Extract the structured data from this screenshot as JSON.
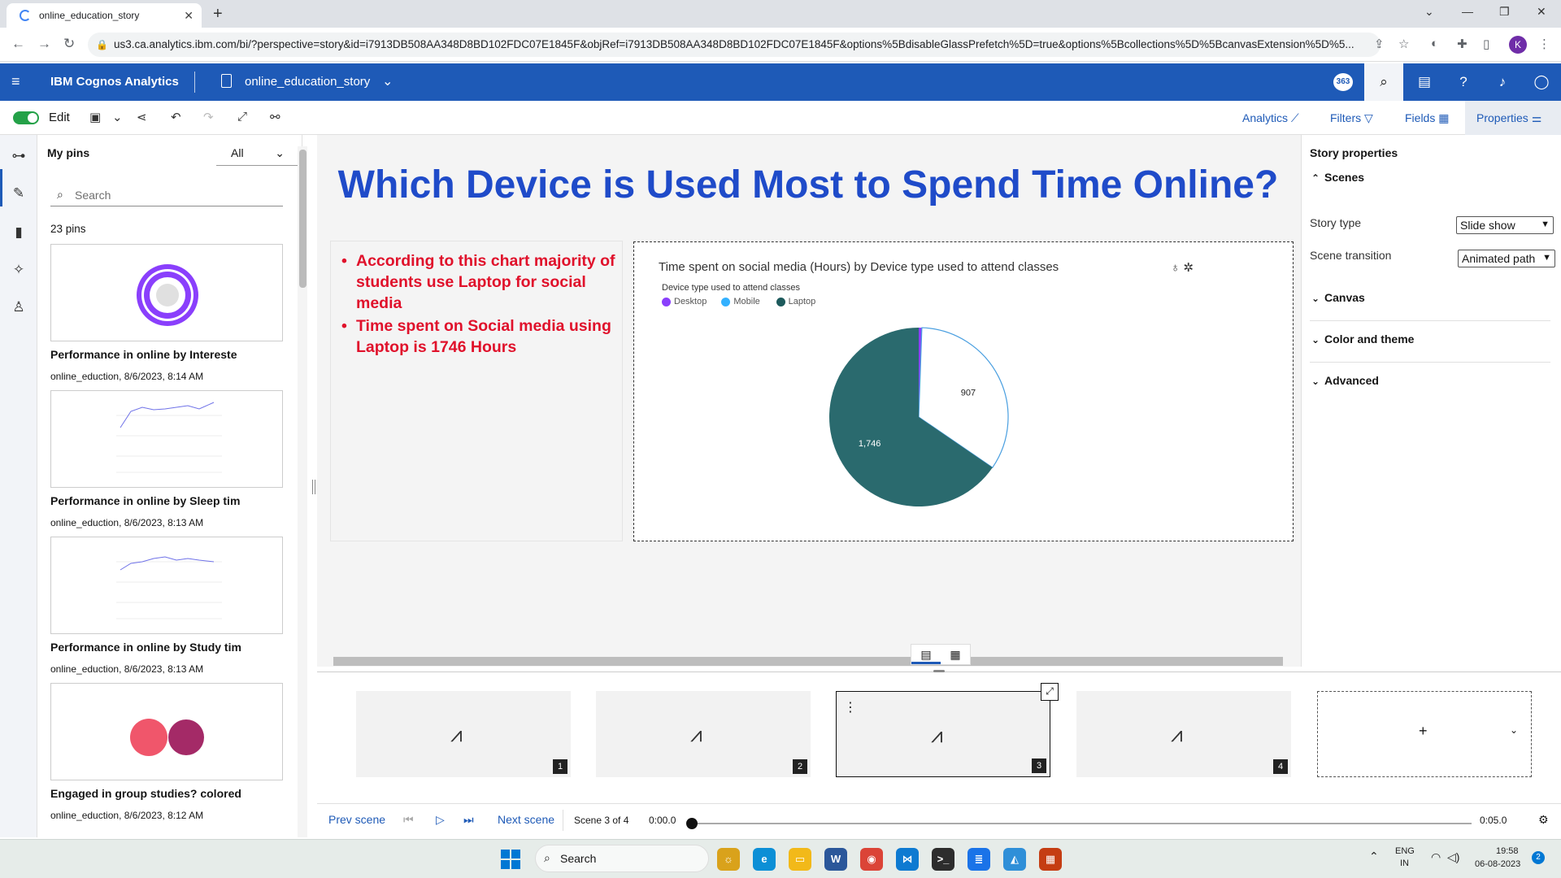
{
  "browser": {
    "tab_title": "online_education_story",
    "url": "us3.ca.analytics.ibm.com/bi/?perspective=story&id=i7913DB508AA348D8BD102FDC07E1845F&objRef=i7913DB508AA348D8BD102FDC07E1845F&options%5BdisableGlassPrefetch%5D=true&options%5Bcollections%5D%5BcanvasExtension%5D%5...",
    "profile_initial": "K"
  },
  "header": {
    "brand": "IBM Cognos Analytics",
    "story_name": "online_education_story",
    "badge": "363"
  },
  "toolbar": {
    "edit_label": "Edit",
    "analytics_label": "Analytics",
    "filters_label": "Filters",
    "fields_label": "Fields",
    "properties_label": "Properties"
  },
  "pins": {
    "title": "My pins",
    "filter_value": "All",
    "search_placeholder": "Search",
    "count": "23 pins",
    "items": [
      {
        "title": "Performance in online by Intereste",
        "meta": "online_eduction, 8/6/2023, 8:14 AM"
      },
      {
        "title": "Performance in online by Sleep tim",
        "meta": "online_eduction, 8/6/2023, 8:13 AM"
      },
      {
        "title": "Performance in online by Study tim",
        "meta": "online_eduction, 8/6/2023, 8:13 AM"
      },
      {
        "title": "Engaged in group studies? colored",
        "meta": "online_eduction, 8/6/2023, 8:12 AM"
      }
    ]
  },
  "slide": {
    "title": "Which Device is Used Most to Spend Time Online?",
    "bullets": [
      "According to this chart majority of students use Laptop for social media",
      "Time spent on Social media using Laptop is 1746 Hours"
    ]
  },
  "chart_data": {
    "type": "pie",
    "title": "Time spent on social media (Hours) by Device type used to attend classes",
    "legend_title": "Device type used to attend classes",
    "legend_position": "top-left",
    "categories": [
      "Desktop",
      "Mobile",
      "Laptop"
    ],
    "values": [
      15,
      907,
      1746
    ],
    "data_labels": [
      "",
      "907",
      "1,746"
    ],
    "colors": [
      "#8a3ffc",
      "#ffffff",
      "#2a6a6e"
    ],
    "legend_colors": [
      "#8a3ffc",
      "#33b1ff",
      "#1d5a5c"
    ]
  },
  "properties": {
    "title": "Story properties",
    "scenes_label": "Scenes",
    "story_type_label": "Story type",
    "story_type_value": "Slide show",
    "scene_transition_label": "Scene transition",
    "scene_transition_value": "Animated path",
    "canvas_label": "Canvas",
    "color_theme_label": "Color and theme",
    "advanced_label": "Advanced"
  },
  "scenes": {
    "cards": [
      {
        "num": "1"
      },
      {
        "num": "2"
      },
      {
        "num": "3"
      },
      {
        "num": "4"
      }
    ],
    "add_label": "+"
  },
  "playback": {
    "prev_label": "Prev scene",
    "next_label": "Next scene",
    "scene_status": "Scene 3 of 4",
    "time_start": "0:00.0",
    "time_end": "0:05.0"
  },
  "taskbar": {
    "search_placeholder": "Search",
    "lang_line1": "ENG",
    "lang_line2": "IN",
    "time": "19:58",
    "date": "06-08-2023",
    "notifications": "2"
  }
}
